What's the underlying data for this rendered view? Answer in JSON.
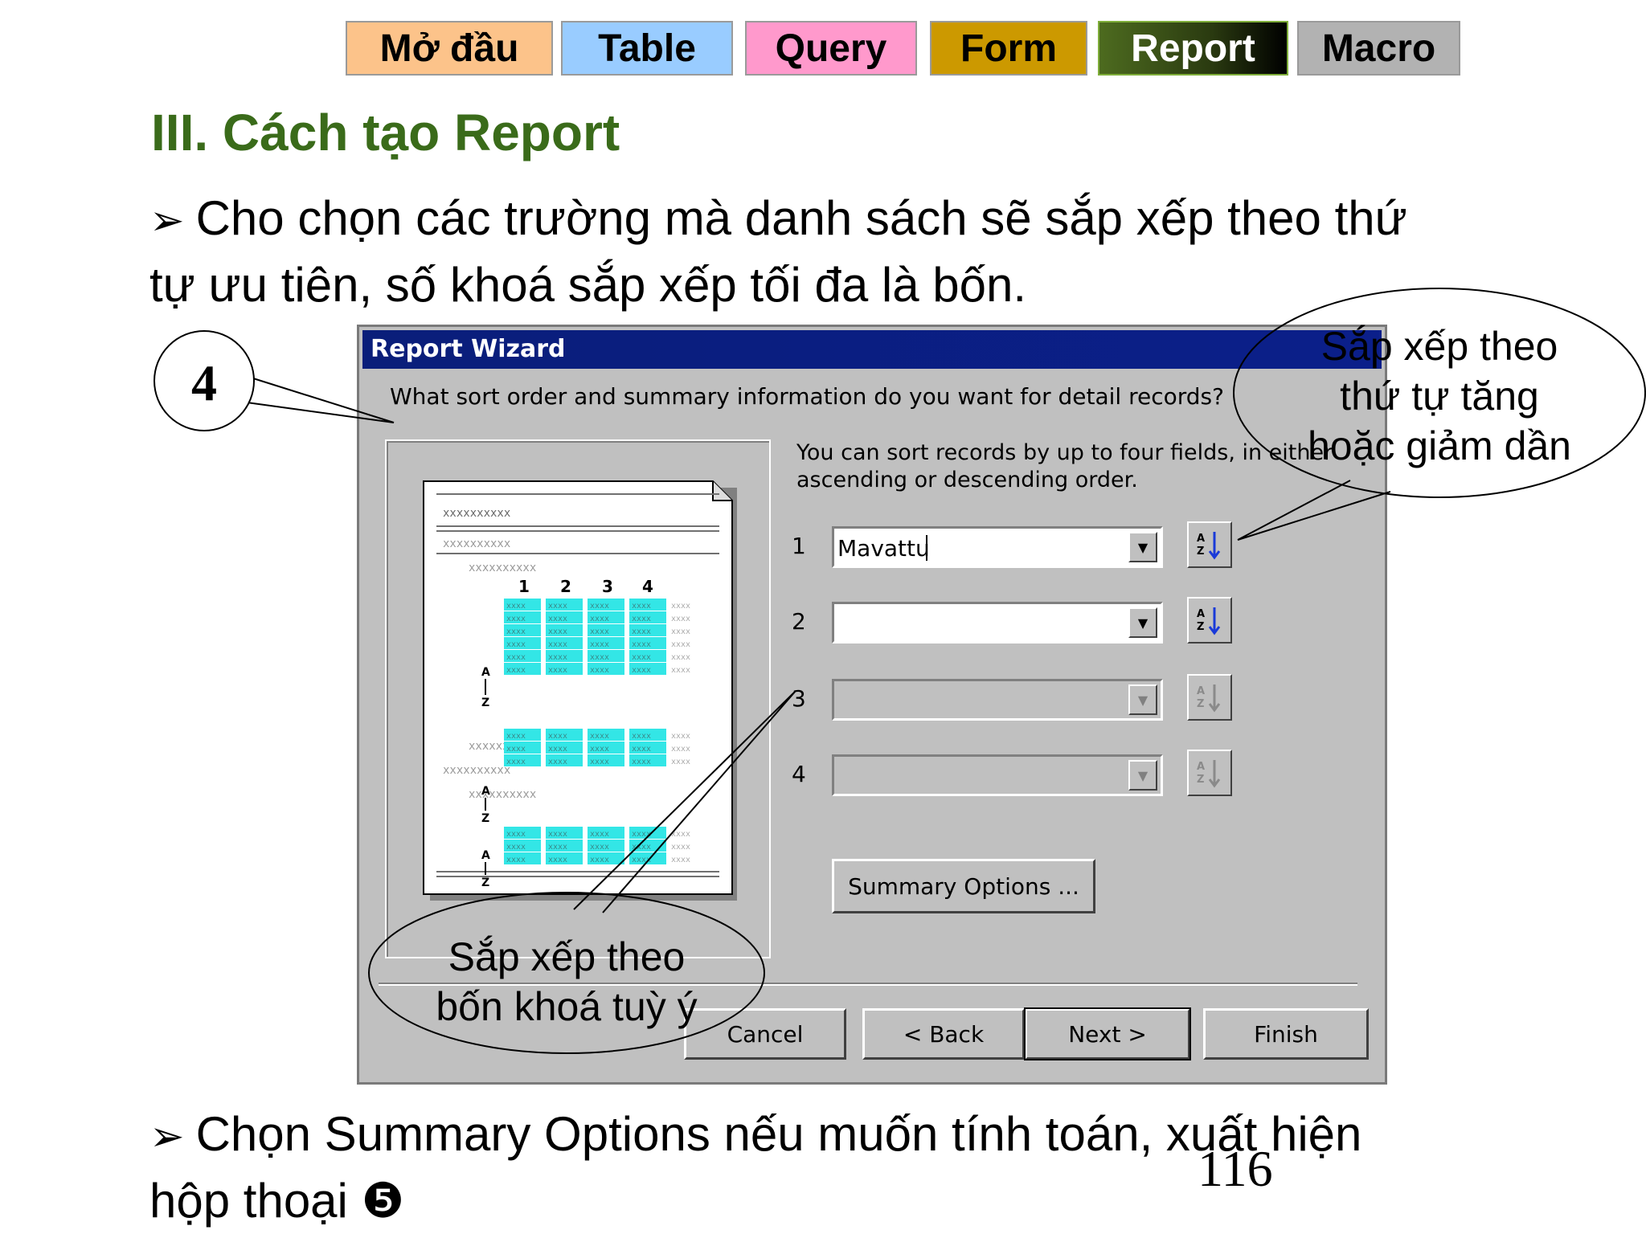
{
  "nav": {
    "tabs": [
      "Mở đầu",
      "Table",
      "Query",
      "Form",
      "Report",
      "Macro"
    ]
  },
  "heading": "III. Cách tạo Report",
  "para1": {
    "bullet": "➢",
    "line1": "Cho chọn các trường mà danh sách sẽ sắp xếp theo thứ",
    "line2": "tự ưu tiên, số khoá sắp xếp tối đa là bốn."
  },
  "dialog": {
    "title": "Report Wizard",
    "question": "What sort order and summary information do you want for detail records?",
    "hint_line1": "You can sort records by up to four fields, in either",
    "hint_line2": "ascending or descending order.",
    "rows": [
      {
        "num": "1",
        "value": "Mavattu"
      },
      {
        "num": "2",
        "value": ""
      },
      {
        "num": "3",
        "value": ""
      },
      {
        "num": "4",
        "value": ""
      }
    ],
    "summary_button": "Summary Options ...",
    "cancel": "Cancel",
    "back": "< Back",
    "next": "Next >",
    "finish": "Finish",
    "preview": {
      "xline": "xxxxxxxxxx",
      "cols": [
        "1",
        "2",
        "3",
        "4"
      ],
      "cell": "xxxx",
      "az": [
        "A",
        "Z"
      ]
    }
  },
  "callouts": {
    "step": "4",
    "right_line1": "Sắp xếp theo",
    "right_line2": "thứ tự tăng",
    "right_line3": "hoặc giảm dần",
    "bottom_line1": "Sắp xếp theo",
    "bottom_line2": "bốn khoá tuỳ ý"
  },
  "para2": {
    "bullet": "➢",
    "line1": "Chọn Summary Options nếu muốn tính toán, xuất hiện",
    "line2": "hộp thoại ❺"
  },
  "page_number": "116",
  "colors": {
    "heading": "#3a6b1a",
    "titlebar": "#0a1e7a",
    "preview_cells": "#33e6e6"
  }
}
